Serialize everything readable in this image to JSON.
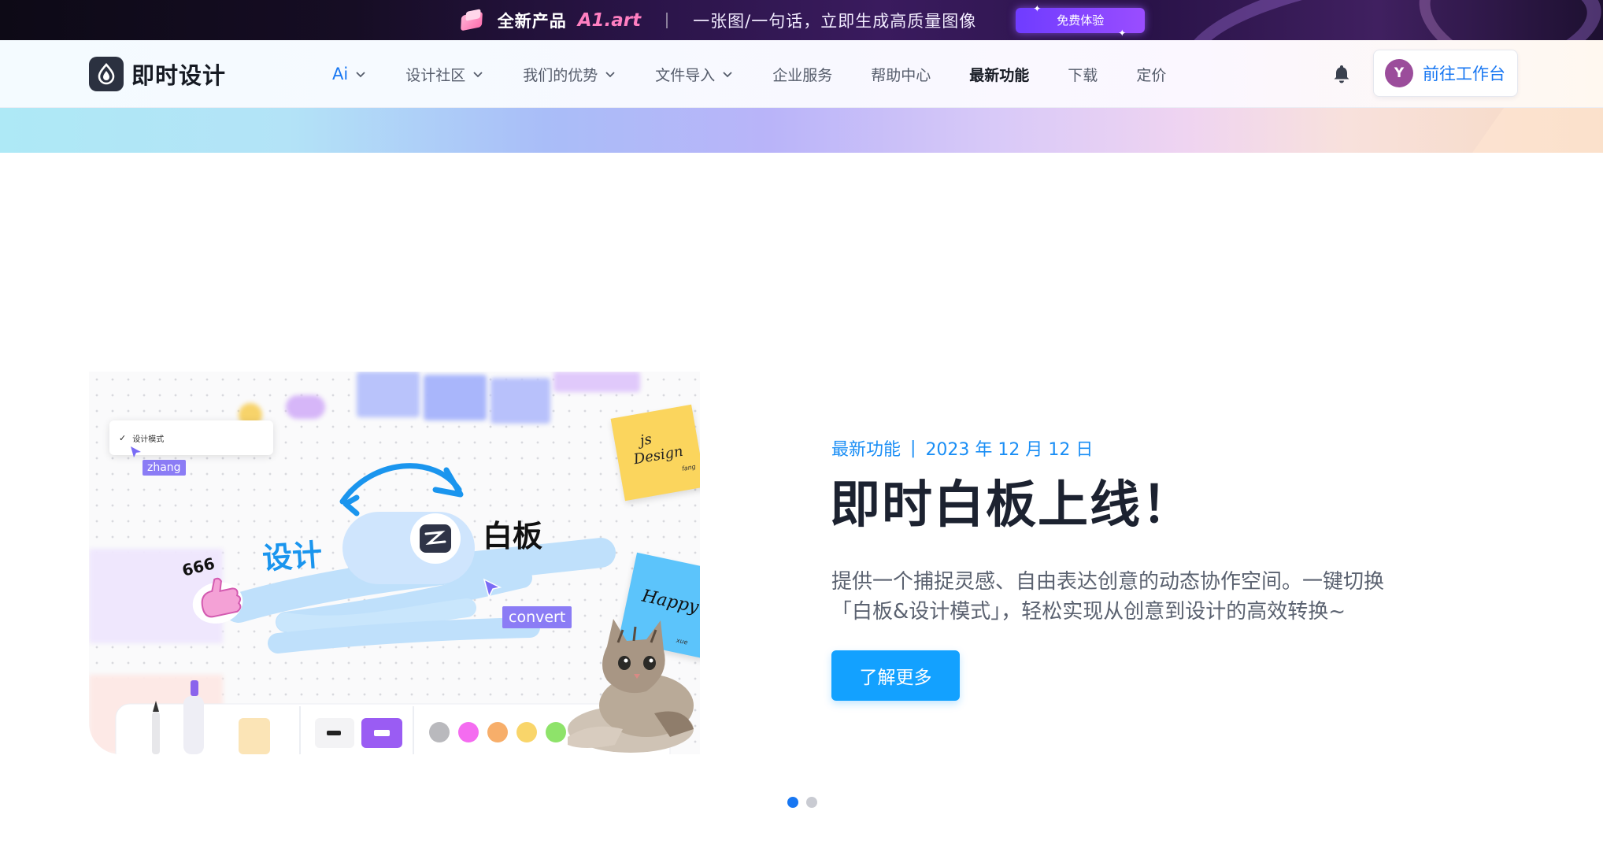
{
  "promo": {
    "product_label": "全新产品",
    "product_name": "A1.art",
    "tagline": "一张图/一句话，立即生成高质量图像",
    "cta": "免费体验"
  },
  "nav": {
    "brand": "即时设计",
    "menu": [
      {
        "label": "Ai",
        "has_dropdown": true
      },
      {
        "label": "设计社区",
        "has_dropdown": true
      },
      {
        "label": "我们的优势",
        "has_dropdown": true
      },
      {
        "label": "文件导入",
        "has_dropdown": true
      },
      {
        "label": "企业服务",
        "has_dropdown": false
      },
      {
        "label": "帮助中心",
        "has_dropdown": false
      },
      {
        "label": "最新功能",
        "has_dropdown": false
      },
      {
        "label": "下载",
        "has_dropdown": false
      },
      {
        "label": "定价",
        "has_dropdown": false
      }
    ],
    "avatar_initial": "Y",
    "workspace_button": "前往工作台"
  },
  "hero": {
    "category": "最新功能",
    "separator": "|",
    "date": "2023 年 12 月 12 日",
    "title": "即时白板上线！",
    "description_line1": "提供一个捕捉灵感、自由表达创意的动态协作空间。一键切换",
    "description_line2": "「白板&设计模式」，轻松实现从创意到设计的高效转换~",
    "cta": "了解更多"
  },
  "illustration": {
    "mode_menu_item": "设计模式",
    "cursor_tag_1": "zhang",
    "cursor_tag_2": "convert",
    "left_word": "设计",
    "right_word": "白板",
    "sticker_text": "666",
    "sticky_note_1_line1": "js",
    "sticky_note_1_line2": "Design",
    "sticky_note_1_sign": "fang",
    "sticky_note_2_text": "Happy",
    "sticky_note_2_sign": "xue",
    "palette": [
      "#b9b9bd",
      "#f46cf0",
      "#f7ae6a",
      "#f9d56a",
      "#8ee36a",
      "#6ee8ee",
      "#8a3cf5",
      "#ffffff"
    ]
  },
  "carousel": {
    "slides": 2,
    "active": 0
  },
  "colors": {
    "primary": "#1877f2",
    "cta": "#13a1ff",
    "title": "#1c2230"
  }
}
